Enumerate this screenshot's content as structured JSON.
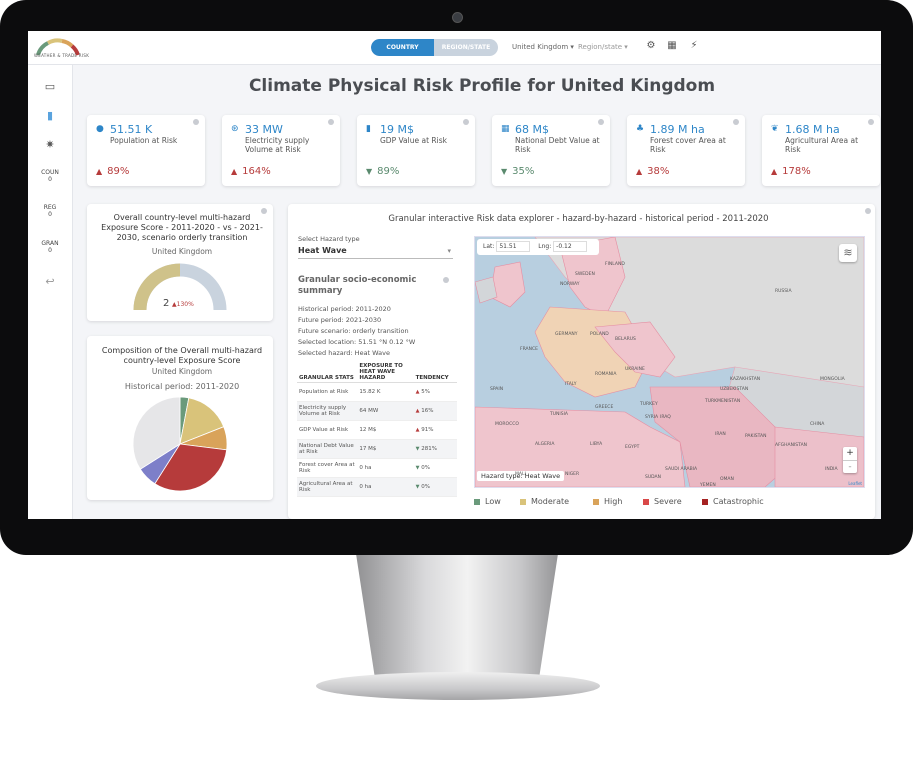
{
  "header": {
    "toggle_country": "COUNTRY",
    "toggle_region": "REGION/STATE",
    "country_select": "United Kingdom",
    "region_select": "Region/state",
    "logo_text": "WEATHER & TRADE RISK"
  },
  "sidebar": {
    "items": [
      {
        "label": "COUN",
        "count": "0"
      },
      {
        "label": "REG",
        "count": "0"
      },
      {
        "label": "GRAN",
        "count": "0"
      }
    ]
  },
  "page_title": "Climate Physical Risk Profile for United Kingdom",
  "kpis": [
    {
      "icon": "person-icon",
      "value": "51.51 K",
      "label": "Population at Risk",
      "trend": "89%",
      "direction": "up"
    },
    {
      "icon": "electricity-icon",
      "value": "33 MW",
      "label": "Electricity supply Volume at Risk",
      "trend": "164%",
      "direction": "up"
    },
    {
      "icon": "bar-chart-icon",
      "value": "19 M$",
      "label": "GDP Value at Risk",
      "trend": "89%",
      "direction": "down"
    },
    {
      "icon": "building-icon",
      "value": "68 M$",
      "label": "National Debt Value at Risk",
      "trend": "35%",
      "direction": "down"
    },
    {
      "icon": "tree-icon",
      "value": "1.89 M ha",
      "label": "Forest cover Area at Risk",
      "trend": "38%",
      "direction": "up"
    },
    {
      "icon": "leaf-icon",
      "value": "1.68 M ha",
      "label": "Agricultural Area at Risk",
      "trend": "178%",
      "direction": "up"
    }
  ],
  "gauge_card": {
    "title": "Overall country-level multi-hazard Exposure Score - 2011-2020 - vs - 2021-2030, scenario orderly transition",
    "subtitle": "United Kingdom",
    "score": "2",
    "change": "130%",
    "fill_fraction": 0.5
  },
  "pie_card": {
    "title": "Composition of the Overall multi-hazard country-level Exposure Score",
    "subtitle": "United Kingdom",
    "period": "Historical period: 2011-2020"
  },
  "chart_data": {
    "type": "pie",
    "slices": [
      {
        "value": 3,
        "color": "#6a9a7b"
      },
      {
        "value": 16,
        "color": "#d9c37a"
      },
      {
        "value": 8,
        "color": "#d9a35a"
      },
      {
        "value": 32,
        "color": "#b63b3b"
      },
      {
        "value": 7,
        "color": "#7d7fc9"
      },
      {
        "value": 34,
        "color": "#e6e6e8"
      }
    ]
  },
  "explorer": {
    "title": "Granular interactive Risk data explorer - hazard-by-hazard - historical period - 2011-2020",
    "hazard_label": "Select Hazard type",
    "hazard_value": "Heat Wave",
    "summary_title": "Granular socio-economic summary",
    "summary_lines": [
      "Historical period: 2011-2020",
      "Future period: 2021-2030",
      "Future scenario: orderly transition",
      "Selected location: 51.51 °N 0.12 °W",
      "Selected hazard: Heat Wave"
    ],
    "table_headers": [
      "GRANULAR STATS",
      "EXPOSURE TO HEAT WAVE HAZARD",
      "TENDENCY"
    ],
    "table_rows": [
      {
        "stat": "Population at Risk",
        "exposure": "15.82 K",
        "tendency": "5%",
        "dir": "up"
      },
      {
        "stat": "Electricity supply Volume at Risk",
        "exposure": "64 MW",
        "tendency": "16%",
        "dir": "up"
      },
      {
        "stat": "GDP Value at Risk",
        "exposure": "12 M$",
        "tendency": "91%",
        "dir": "up"
      },
      {
        "stat": "National Debt Value at Risk",
        "exposure": "17 M$",
        "tendency": "281%",
        "dir": "down"
      },
      {
        "stat": "Forest cover Area at Risk",
        "exposure": "0 ha",
        "tendency": "0%",
        "dir": "down"
      },
      {
        "stat": "Agricultural Area at Risk",
        "exposure": "0 ha",
        "tendency": "0%",
        "dir": "down"
      }
    ],
    "map": {
      "lat_label": "Lat:",
      "lat_value": "51.51",
      "lng_label": "Lng:",
      "lng_value": "-0.12",
      "hazard_badge": "Hazard type: Heat Wave",
      "zoom_in": "+",
      "zoom_out": "-",
      "attribution": "Leaflet",
      "place_labels": [
        "RUSSIA",
        "KAZAKHSTAN",
        "MONGOLIA",
        "CHINA",
        "ALGERIA",
        "LIBYA",
        "EGYPT",
        "SAUDI ARABIA",
        "IRAN",
        "AFGHANISTAN",
        "PAKISTAN",
        "INDIA",
        "UKRAINE",
        "TURKEY",
        "IRAQ",
        "SYRIA",
        "OMAN",
        "MALI",
        "NIGER",
        "SUDAN",
        "TURKMENISTAN",
        "UZBEKISTAN",
        "GREECE",
        "ITALY",
        "FRANCE",
        "SPAIN",
        "GERMANY",
        "POLAND",
        "ROMANIA",
        "BELARUS",
        "SWEDEN",
        "FINLAND",
        "NORWAY",
        "MOROCCO",
        "TUNISIA",
        "YEMEN"
      ]
    },
    "legend": [
      {
        "label": "Low",
        "color": "#6a9a7b"
      },
      {
        "label": "Moderate",
        "color": "#d9c37a"
      },
      {
        "label": "High",
        "color": "#d9a35a"
      },
      {
        "label": "Severe",
        "color": "#d94848"
      },
      {
        "label": "Catastrophic",
        "color": "#a52222"
      }
    ]
  }
}
